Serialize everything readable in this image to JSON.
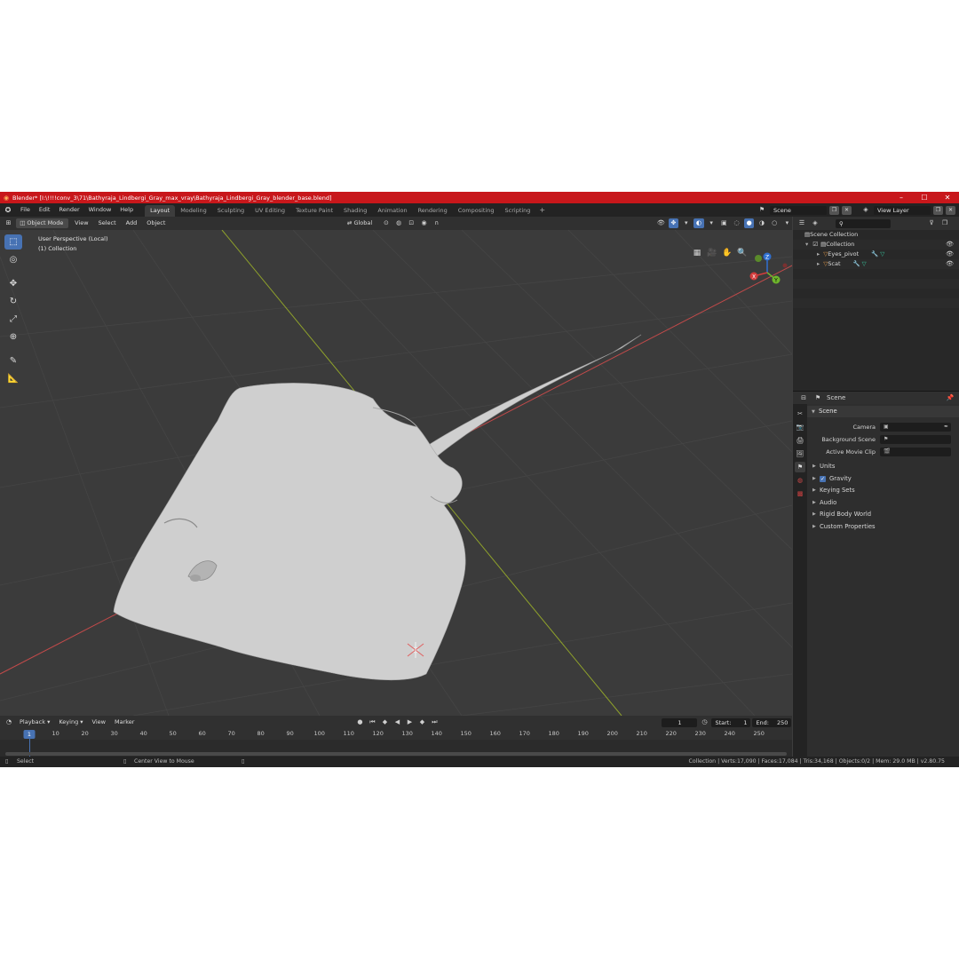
{
  "window": {
    "title": "Blender* [I:\\!!!!conv_3\\71\\Bathyraja_Lindbergi_Gray_max_vray\\Bathyraja_Lindbergi_Gray_blender_base.blend]",
    "minimize": "–",
    "maximize": "☐",
    "close": "✕"
  },
  "menu": [
    "File",
    "Edit",
    "Render",
    "Window",
    "Help"
  ],
  "workspaces": [
    "Layout",
    "Modeling",
    "Sculpting",
    "UV Editing",
    "Texture Paint",
    "Shading",
    "Animation",
    "Rendering",
    "Compositing",
    "Scripting"
  ],
  "workspace_add": "+",
  "scene_selector": {
    "scene": "Scene",
    "view_layer": "View Layer"
  },
  "viewport_header": {
    "mode": "Object Mode",
    "menus": [
      "View",
      "Select",
      "Add",
      "Object"
    ],
    "orientation": "Global"
  },
  "viewport": {
    "perspective": "User Perspective (Local)",
    "collection": "(1) Collection",
    "gizmo": {
      "z": "Z",
      "y": "Y",
      "x": "X"
    },
    "colors": {
      "x_axis": "#c04a4a",
      "y_axis": "#8fa22b",
      "mesh": "#cfcfcf"
    }
  },
  "timeline": {
    "menus": [
      "Playback",
      "Keying",
      "View",
      "Marker"
    ],
    "current_frame": "1",
    "start_label": "Start:",
    "start": "1",
    "end_label": "End:",
    "end": "250",
    "ticks": [
      "10",
      "20",
      "30",
      "40",
      "50",
      "60",
      "70",
      "80",
      "90",
      "100",
      "110",
      "120",
      "130",
      "140",
      "150",
      "160",
      "170",
      "180",
      "190",
      "200",
      "210",
      "220",
      "230",
      "240",
      "250"
    ],
    "cursor_label": "1"
  },
  "outliner": {
    "root": "Scene Collection",
    "collection": "Collection",
    "items": [
      "Eyes_pivot",
      "Scat"
    ]
  },
  "properties": {
    "context": "Scene",
    "panel": "Scene",
    "fields": [
      {
        "label": "Camera",
        "value": ""
      },
      {
        "label": "Background Scene",
        "value": ""
      },
      {
        "label": "Active Movie Clip",
        "value": ""
      }
    ],
    "sections": [
      "Units",
      "Gravity",
      "Keying Sets",
      "Audio",
      "Rigid Body World",
      "Custom Properties"
    ]
  },
  "status": {
    "select": "Select",
    "center_view": "Center View to Mouse",
    "stats": "Collection | Verts:17,090 | Faces:17,084 | Tris:34,168 | Objects:0/2 | Mem: 29.0 MB | v2.80.75"
  }
}
